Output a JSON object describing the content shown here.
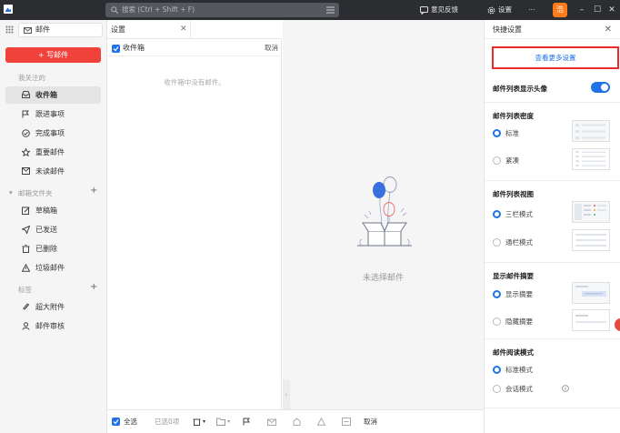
{
  "titlebar": {
    "search_placeholder": "搜索 (Ctrl + Shift + F)",
    "feedback": "意见反馈",
    "settings": "设置",
    "avatar_char": "浩"
  },
  "sidebar": {
    "mail_tab": "邮件",
    "compose": "+  写邮件",
    "section_followed": "我关注的",
    "followed_items": [
      {
        "label": "收件箱",
        "icon": "inbox-icon",
        "active": true
      },
      {
        "label": "跟进事项",
        "icon": "flag-icon"
      },
      {
        "label": "完成事项",
        "icon": "check-circle-icon"
      },
      {
        "label": "重要邮件",
        "icon": "star-icon"
      },
      {
        "label": "未读邮件",
        "icon": "unread-mail-icon"
      }
    ],
    "section_folders": "邮箱文件夹",
    "folder_items": [
      {
        "label": "草稿箱",
        "icon": "draft-icon"
      },
      {
        "label": "已发送",
        "icon": "send-icon"
      },
      {
        "label": "已删除",
        "icon": "trash-icon"
      },
      {
        "label": "垃圾邮件",
        "icon": "warning-icon"
      }
    ],
    "section_tags": "标签",
    "tag_items": [
      {
        "label": "超大附件",
        "icon": "attachment-icon"
      },
      {
        "label": "邮件审核",
        "icon": "user-icon"
      }
    ]
  },
  "listcol": {
    "tab_label": "设置",
    "tab_close": "✕",
    "inbox_label": "收件箱",
    "cancel": "取消",
    "empty_text": "收件箱中没有邮件。"
  },
  "reader": {
    "no_mail": "未选择邮件"
  },
  "bottombar": {
    "select_all": "全选",
    "selected_count": "已选0项",
    "cancel": "取消"
  },
  "settings": {
    "title": "快捷设置",
    "more_settings": "查看更多设置",
    "show_avatar": "邮件列表显示头像",
    "avatar_enabled": true,
    "density": {
      "title": "邮件列表密度",
      "options": [
        "标准",
        "紧凑"
      ],
      "selected": 0
    },
    "view": {
      "title": "邮件列表视图",
      "options": [
        "三栏模式",
        "通栏模式"
      ],
      "selected": 0
    },
    "summary": {
      "title": "显示邮件摘要",
      "options": [
        "显示摘要",
        "隐藏摘要"
      ],
      "selected": 0
    },
    "reading": {
      "title": "邮件阅读模式",
      "options": [
        "标准模式",
        "会话模式"
      ],
      "selected": 0
    }
  },
  "colors": {
    "accent": "#1e73e8",
    "compose_red": "#f0413a",
    "highlight_border": "#ee2a2a",
    "titlebar": "#2b2d31",
    "avatar": "#ff7a1a"
  }
}
